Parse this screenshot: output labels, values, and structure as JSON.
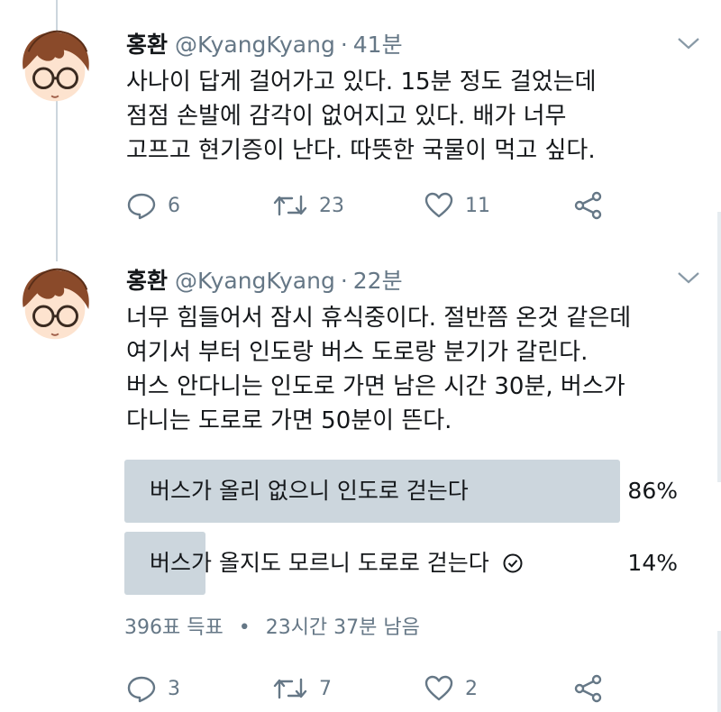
{
  "tweets": [
    {
      "name": "홍환",
      "handle": "@KyangKyang",
      "time": "41분",
      "lines": [
        "사나이 답게 걸어가고 있다. 15분 정도 걸었는데",
        "점점 손발에 감각이 없어지고 있다. 배가 너무",
        "고프고 현기증이 난다. 따뜻한 국물이 먹고 싶다."
      ],
      "replies": "6",
      "retweets": "23",
      "likes": "11"
    },
    {
      "name": "홍환",
      "handle": "@KyangKyang",
      "time": "22분",
      "lines": [
        "너무 힘들어서 잠시 휴식중이다. 절반쯤 온것 같은데",
        "여기서 부터 인도랑 버스 도로랑 분기가 갈린다.",
        "버스 안다니는 인도로 가면 남은 시간 30분, 버스가",
        "다니는 도로로 가면 50분이 뜬다."
      ],
      "poll": {
        "options": [
          {
            "label": "버스가 올리 없으니 인도로 걷는다",
            "percent_label": "86%",
            "fraction": 0.86,
            "selected": false
          },
          {
            "label": "버스가 올지도 모르니 도로로 걷는다",
            "percent_label": "14%",
            "fraction": 0.14,
            "selected": true
          }
        ],
        "votes": "396표 득표",
        "separator": "•",
        "remaining": "23시간 37분 남음"
      },
      "replies": "3",
      "retweets": "7",
      "likes": "2"
    }
  ],
  "separator_dot": "·",
  "icons": {
    "reply": "reply-icon",
    "retweet": "retweet-icon",
    "like": "heart-icon",
    "share": "share-icon",
    "menu": "chevron-down-icon",
    "vote": "check-circle-icon"
  },
  "colors": {
    "text": "#14171a",
    "secondary": "#657786",
    "poll_bar": "#ccd6dd",
    "thread_line": "#ccd6dd"
  }
}
